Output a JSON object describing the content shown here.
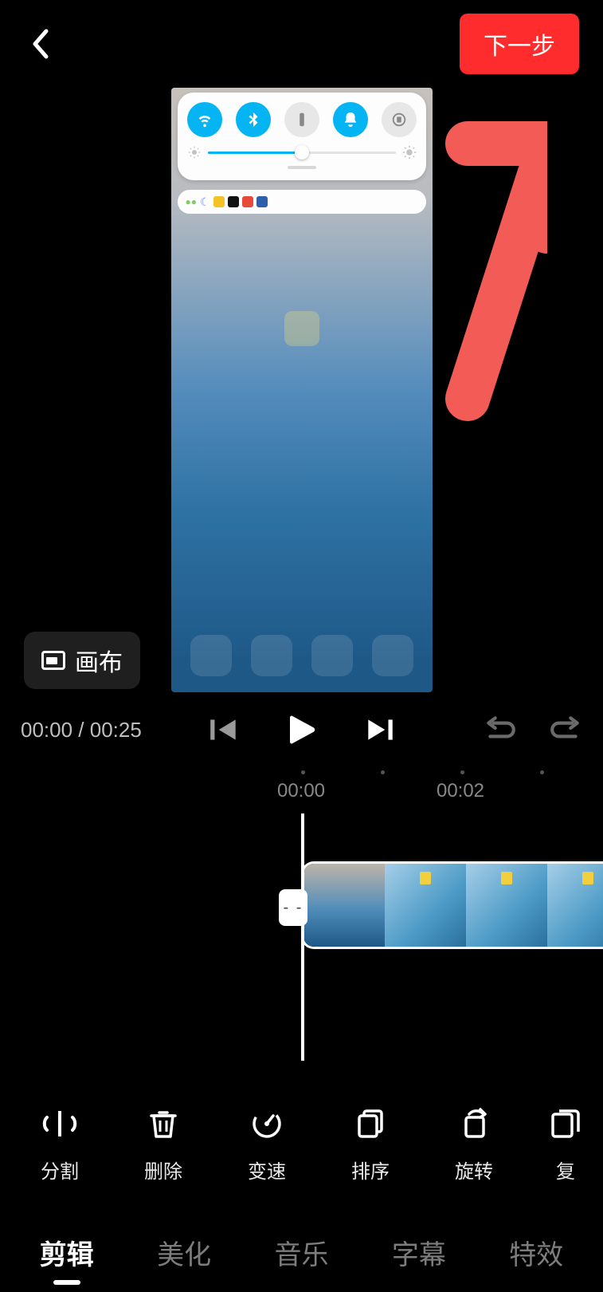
{
  "header": {
    "next_label": "下一步"
  },
  "canvas": {
    "label": "画布"
  },
  "playback": {
    "current": "00:00",
    "total": "00:25"
  },
  "timeline": {
    "marks": [
      "00:00",
      "00:02"
    ]
  },
  "tools": [
    {
      "id": "split",
      "label": "分割"
    },
    {
      "id": "delete",
      "label": "删除"
    },
    {
      "id": "speed",
      "label": "变速"
    },
    {
      "id": "sort",
      "label": "排序"
    },
    {
      "id": "rotate",
      "label": "旋转"
    },
    {
      "id": "copy",
      "label": "复"
    }
  ],
  "tabs": [
    {
      "id": "edit",
      "label": "剪辑",
      "active": true
    },
    {
      "id": "beauty",
      "label": "美化"
    },
    {
      "id": "music",
      "label": "音乐"
    },
    {
      "id": "subtitle",
      "label": "字幕"
    },
    {
      "id": "effect",
      "label": "特效"
    }
  ],
  "trim_handle": "- -"
}
